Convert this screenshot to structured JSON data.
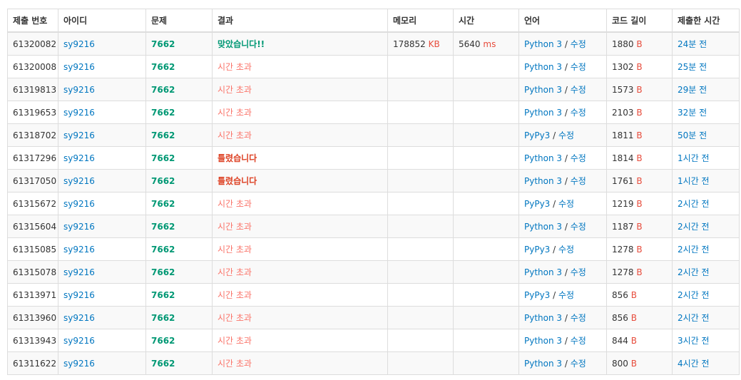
{
  "headers": [
    "제출 번호",
    "아이디",
    "문제",
    "결과",
    "메모리",
    "시간",
    "언어",
    "코드 길이",
    "제출한 시간"
  ],
  "units": {
    "memory": "KB",
    "time": "ms",
    "code": "B"
  },
  "edit_label": "수정",
  "colors": {
    "link": "#0076c0",
    "problem": "#009874",
    "accepted": "#009874",
    "time_limit": "#fa7268",
    "wrong": "#dd4124",
    "unit": "#e74c3c"
  },
  "rows": [
    {
      "id": "61320082",
      "user": "sy9216",
      "problem": "7662",
      "result": "맞았습니다!!",
      "result_type": "ac",
      "memory": "178852",
      "time": "5640",
      "language": "Python 3",
      "code_length": "1880",
      "submitted": "24분 전"
    },
    {
      "id": "61320008",
      "user": "sy9216",
      "problem": "7662",
      "result": "시간 초과",
      "result_type": "tle",
      "memory": "",
      "time": "",
      "language": "Python 3",
      "code_length": "1302",
      "submitted": "25분 전"
    },
    {
      "id": "61319813",
      "user": "sy9216",
      "problem": "7662",
      "result": "시간 초과",
      "result_type": "tle",
      "memory": "",
      "time": "",
      "language": "Python 3",
      "code_length": "1573",
      "submitted": "29분 전"
    },
    {
      "id": "61319653",
      "user": "sy9216",
      "problem": "7662",
      "result": "시간 초과",
      "result_type": "tle",
      "memory": "",
      "time": "",
      "language": "Python 3",
      "code_length": "2103",
      "submitted": "32분 전"
    },
    {
      "id": "61318702",
      "user": "sy9216",
      "problem": "7662",
      "result": "시간 초과",
      "result_type": "tle",
      "memory": "",
      "time": "",
      "language": "PyPy3",
      "code_length": "1811",
      "submitted": "50분 전"
    },
    {
      "id": "61317296",
      "user": "sy9216",
      "problem": "7662",
      "result": "틀렸습니다",
      "result_type": "wa",
      "memory": "",
      "time": "",
      "language": "Python 3",
      "code_length": "1814",
      "submitted": "1시간 전"
    },
    {
      "id": "61317050",
      "user": "sy9216",
      "problem": "7662",
      "result": "틀렸습니다",
      "result_type": "wa",
      "memory": "",
      "time": "",
      "language": "Python 3",
      "code_length": "1761",
      "submitted": "1시간 전"
    },
    {
      "id": "61315672",
      "user": "sy9216",
      "problem": "7662",
      "result": "시간 초과",
      "result_type": "tle",
      "memory": "",
      "time": "",
      "language": "PyPy3",
      "code_length": "1219",
      "submitted": "2시간 전"
    },
    {
      "id": "61315604",
      "user": "sy9216",
      "problem": "7662",
      "result": "시간 초과",
      "result_type": "tle",
      "memory": "",
      "time": "",
      "language": "Python 3",
      "code_length": "1187",
      "submitted": "2시간 전"
    },
    {
      "id": "61315085",
      "user": "sy9216",
      "problem": "7662",
      "result": "시간 초과",
      "result_type": "tle",
      "memory": "",
      "time": "",
      "language": "PyPy3",
      "code_length": "1278",
      "submitted": "2시간 전"
    },
    {
      "id": "61315078",
      "user": "sy9216",
      "problem": "7662",
      "result": "시간 초과",
      "result_type": "tle",
      "memory": "",
      "time": "",
      "language": "Python 3",
      "code_length": "1278",
      "submitted": "2시간 전"
    },
    {
      "id": "61313971",
      "user": "sy9216",
      "problem": "7662",
      "result": "시간 초과",
      "result_type": "tle",
      "memory": "",
      "time": "",
      "language": "PyPy3",
      "code_length": "856",
      "submitted": "2시간 전"
    },
    {
      "id": "61313960",
      "user": "sy9216",
      "problem": "7662",
      "result": "시간 초과",
      "result_type": "tle",
      "memory": "",
      "time": "",
      "language": "Python 3",
      "code_length": "856",
      "submitted": "2시간 전"
    },
    {
      "id": "61313943",
      "user": "sy9216",
      "problem": "7662",
      "result": "시간 초과",
      "result_type": "tle",
      "memory": "",
      "time": "",
      "language": "Python 3",
      "code_length": "844",
      "submitted": "3시간 전"
    },
    {
      "id": "61311622",
      "user": "sy9216",
      "problem": "7662",
      "result": "시간 초과",
      "result_type": "tle",
      "memory": "",
      "time": "",
      "language": "Python 3",
      "code_length": "800",
      "submitted": "4시간 전"
    }
  ]
}
